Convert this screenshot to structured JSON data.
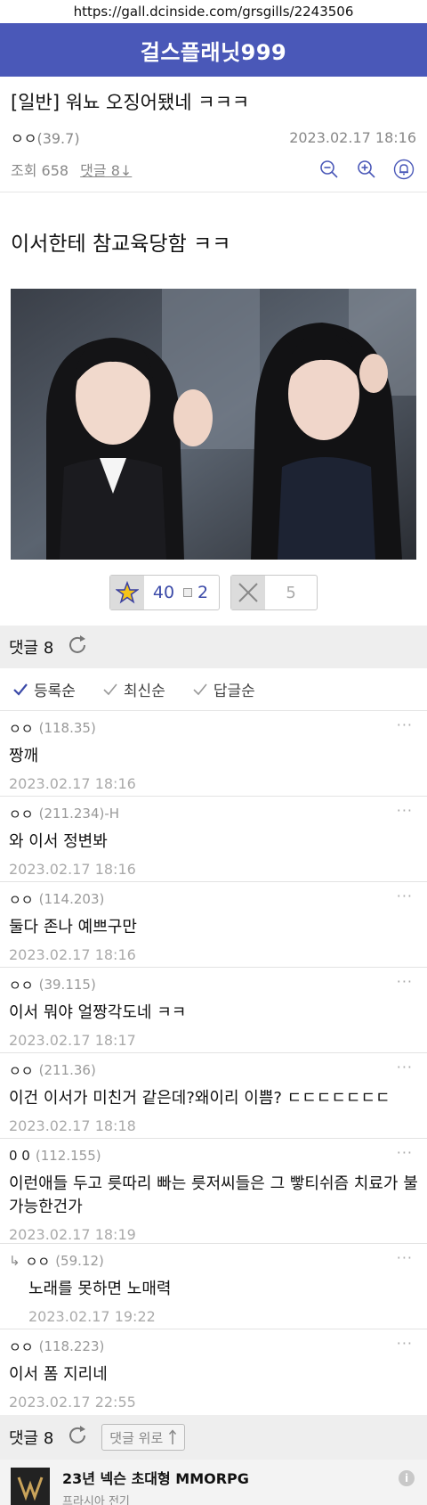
{
  "browser": {
    "url": "https://gall.dcinside.com/grsgills/2243506"
  },
  "header": {
    "title": "걸스플래닛999"
  },
  "post": {
    "title": "[일반] 워뇨 오징어됐네 ㅋㅋㅋ",
    "author": "ㅇㅇ",
    "author_ip": "(39.7)",
    "date": "2023.02.17 18:16",
    "views": "조회 658",
    "comment_link": "댓글 8↓",
    "body": "이서한테 참교육당함 ㅋㅋ"
  },
  "votes": {
    "up": "40",
    "fixed": "2",
    "down": "5"
  },
  "comment_section": {
    "label": "댓글 8",
    "sorts": [
      "등록순",
      "최신순",
      "답글순"
    ],
    "comments": [
      {
        "author": "ㅇㅇ",
        "ip": "(118.35)",
        "text": "짱깨",
        "date": "2023.02.17 18:16"
      },
      {
        "author": "ㅇㅇ",
        "ip": "(211.234)-H",
        "text": "와 이서 정변봐",
        "date": "2023.02.17 18:16"
      },
      {
        "author": "ㅇㅇ",
        "ip": "(114.203)",
        "text": "둘다 존나 예쁘구만",
        "date": "2023.02.17 18:16"
      },
      {
        "author": "ㅇㅇ",
        "ip": "(39.115)",
        "text": "이서 뭐야 얼짱각도네 ㅋㅋ",
        "date": "2023.02.17 18:17"
      },
      {
        "author": "ㅇㅇ",
        "ip": "(211.36)",
        "text": "이건 이서가 미친거 같은데?왜이리 이쁨? ㄷㄷㄷㄷㄷㄷㄷ",
        "date": "2023.02.17 18:18"
      },
      {
        "author": "0 0",
        "ip": "(112.155)",
        "text": "이런애들 두고 릇따리 빠는 릇저씨들은 그 빻티쉬즘 치료가 불가능한건가",
        "date": "2023.02.17 18:19"
      },
      {
        "author": "ㅇㅇ",
        "ip": "(59.12)",
        "text": "노래를 못하면 노매력",
        "date": "2023.02.17 19:22",
        "reply_arrow": "↳"
      },
      {
        "author": "ㅇㅇ",
        "ip": "(118.223)",
        "text": "이서 폼 지리네",
        "date": "2023.02.17 22:55"
      }
    ],
    "more_icon": "···"
  },
  "bottom": {
    "label": "댓글 8",
    "top_button": "댓글 위로"
  },
  "ad": {
    "title": "23년 넥슨 초대형 MMORPG",
    "subtitle": "프라시아 전기",
    "info": "i"
  },
  "colors": {
    "header_bg": "#4a58b8",
    "accent": "#3b4aa8",
    "link": "#3b4aa8"
  }
}
